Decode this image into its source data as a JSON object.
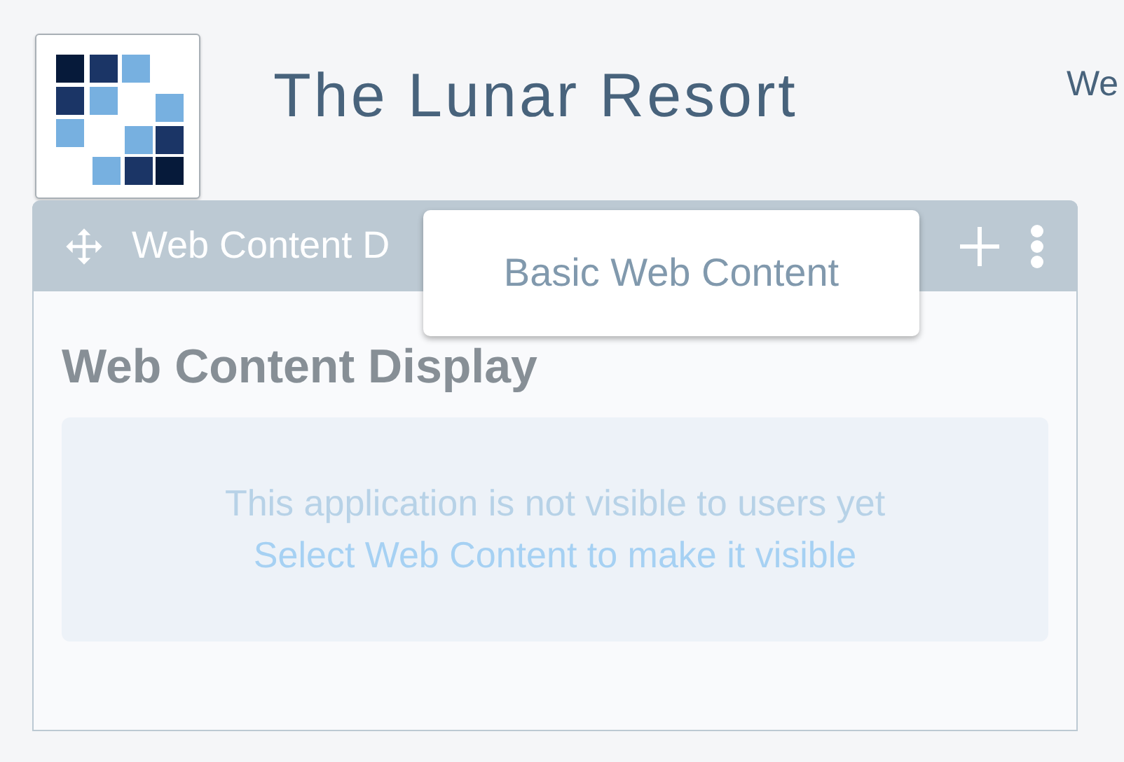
{
  "site": {
    "title": "The Lunar Resort",
    "nav_items": [
      "We"
    ]
  },
  "portlet": {
    "header_title": "Web Content D",
    "title": "Web Content Display",
    "message": "This application is not visible to users yet",
    "link": "Select Web Content to make it visible"
  },
  "popup": {
    "items": [
      "Basic Web Content"
    ]
  }
}
